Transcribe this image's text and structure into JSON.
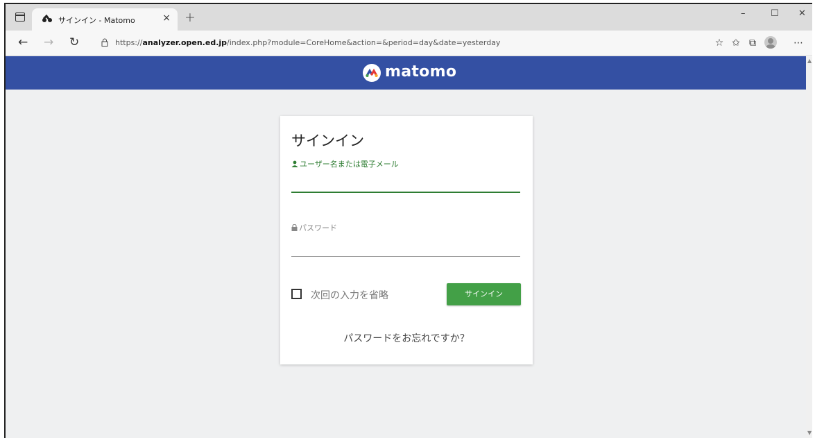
{
  "browser": {
    "tab_title": "サインイン - Matomo",
    "tab_close": "×",
    "new_tab": "+",
    "window_controls": [
      "–",
      "☐",
      "✕"
    ],
    "url_scheme": "https://",
    "url_host": "analyzer.open.ed.jp",
    "url_path": "/index.php?module=CoreHome&action=&period=day&date=yesterday",
    "icons": [
      "tab-actions-icon",
      "back-icon",
      "forward-icon",
      "refresh-icon",
      "lock-icon",
      "favorites-add-icon",
      "favorites-icon",
      "collections-icon",
      "profile-icon",
      "more-icon"
    ]
  },
  "header": {
    "brand": "matomo",
    "background_color": "#3450a3"
  },
  "login": {
    "title": "サインイン",
    "username_label": "ユーザー名または電子メール",
    "username_value": "",
    "password_label": "パスワード",
    "password_value": "",
    "remember_label": "次回の入力を省略",
    "remember_checked": false,
    "submit_label": "サインイン",
    "forgot_link": "パスワードをお忘れですか？",
    "accent_color": "#43a047"
  }
}
